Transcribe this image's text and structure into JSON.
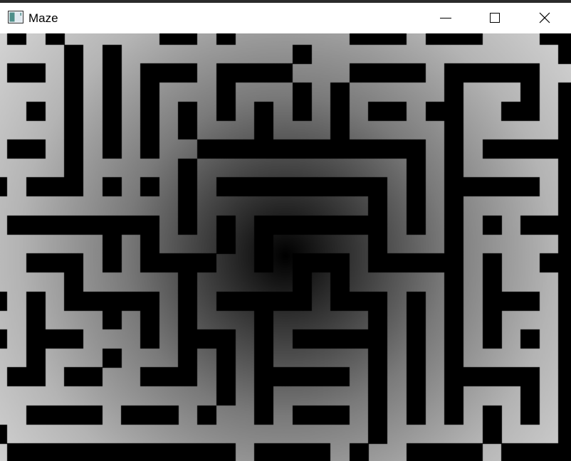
{
  "window": {
    "title": "Maze",
    "icon": "app-window-icon",
    "controls": [
      "minimize-icon",
      "maximize-icon",
      "close-icon"
    ]
  },
  "maze": {
    "wall_color": "#000000",
    "path_color_center": "#000000",
    "path_color_edge": "#d2d2d2"
  }
}
